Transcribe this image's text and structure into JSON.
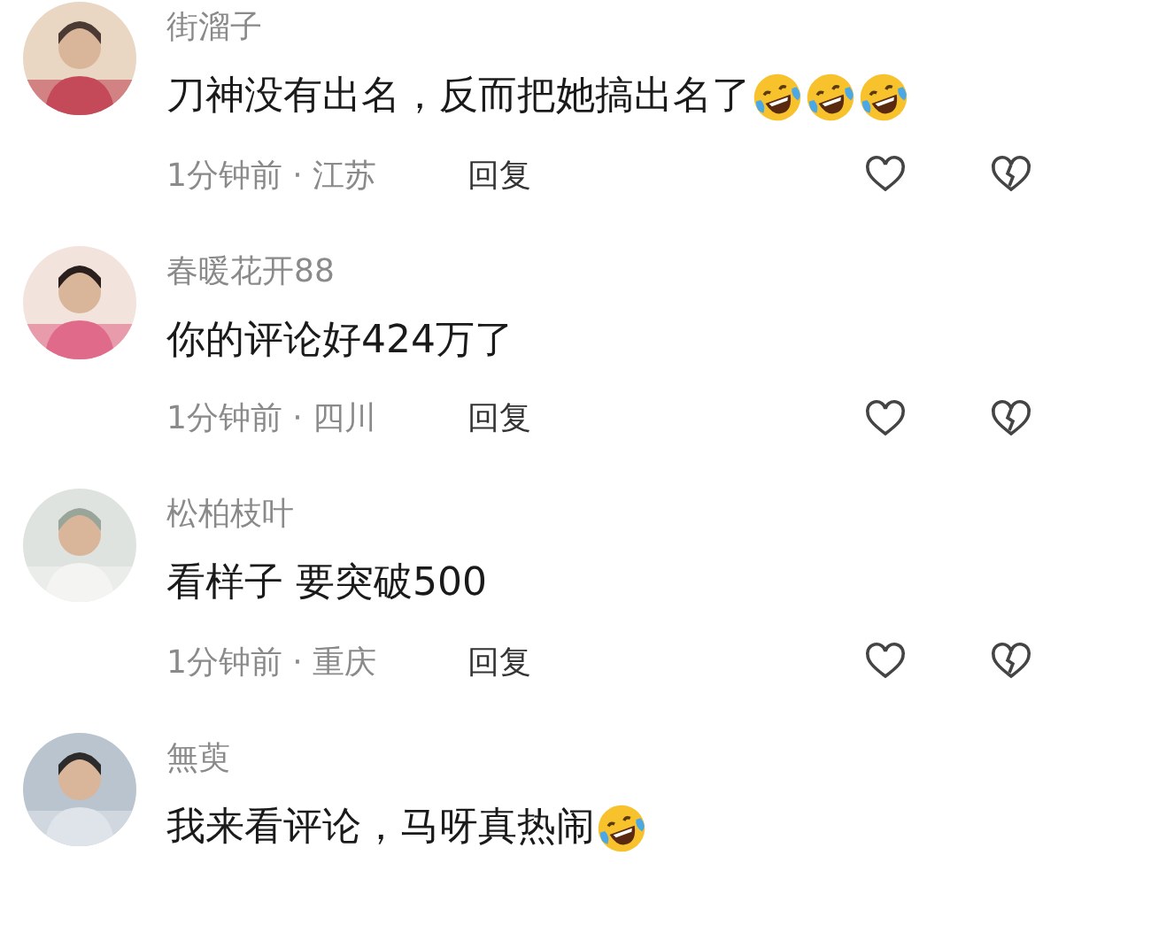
{
  "comments": [
    {
      "user": "街溜子",
      "text": "刀神没有出名，反而把她搞出名了",
      "emojis": [
        {
          "kind": "laugh"
        },
        {
          "kind": "laugh"
        },
        {
          "kind": "laugh"
        }
      ],
      "time": "1分钟前 · 江苏",
      "reply": "回复"
    },
    {
      "user": "春暖花开88",
      "text": "你的评论好424万了",
      "time": "1分钟前 · 四川",
      "reply": "回复"
    },
    {
      "user": "松柏枝叶",
      "text": "看样子 要突破500",
      "time": "1分钟前 · 重庆",
      "reply": "回复"
    },
    {
      "user": "無萸",
      "text": "我来看评论，马呀真热闹",
      "emojis": [
        {
          "kind": "laugh"
        }
      ]
    }
  ]
}
